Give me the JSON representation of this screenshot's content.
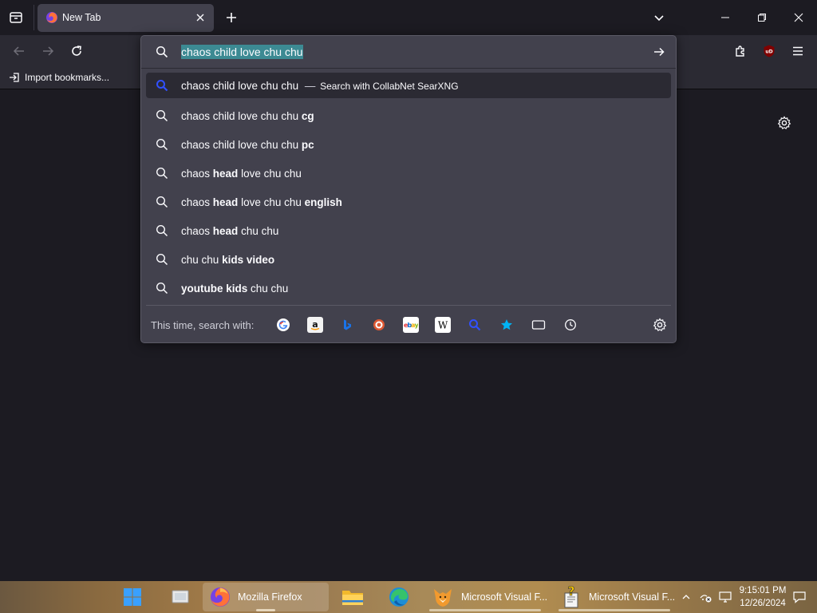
{
  "browser": {
    "tab_title": "New Tab",
    "bookmarks_import_label": "Import bookmarks..."
  },
  "urlbar": {
    "input_value": "chaos child love chu chu",
    "heuristic": {
      "text": "chaos child love chu chu",
      "dash": "—",
      "action": "Search with CollabNet SearXNG"
    },
    "suggestions": [
      {
        "plain": "chaos child love chu chu",
        "bold": "cg",
        "rest": ""
      },
      {
        "plain": "chaos child love chu chu",
        "bold": "pc",
        "rest": ""
      },
      {
        "plain": "chaos",
        "bold": "head",
        "rest": "love chu chu"
      },
      {
        "plain": "chaos",
        "bold": "head",
        "rest": "love chu chu",
        "bold2": "english"
      },
      {
        "plain": "chaos",
        "bold": "head",
        "rest": "chu chu"
      },
      {
        "plain": "chu chu",
        "bold": "kids video",
        "rest": ""
      },
      {
        "plain": "",
        "bold": "youtube kids",
        "rest": "chu chu"
      }
    ],
    "one_off_label": "This time, search with:",
    "engines": [
      {
        "name": "google-icon",
        "color": "#4285f4"
      },
      {
        "name": "amazon-icon",
        "color": "#f3f3f3"
      },
      {
        "name": "bing-icon",
        "color": "#1a73e8"
      },
      {
        "name": "duckduckgo-icon",
        "color": "#de5833"
      },
      {
        "name": "ebay-icon",
        "color": "#ffffff"
      },
      {
        "name": "wikipedia-icon",
        "color": "#ffffff"
      },
      {
        "name": "searxng-icon",
        "color": "#3050ff"
      },
      {
        "name": "bookmarks-star-icon",
        "color": "#00b3f4"
      },
      {
        "name": "tabs-icon",
        "color": "#fbfbfe"
      },
      {
        "name": "history-icon",
        "color": "#fbfbfe"
      }
    ]
  },
  "taskbar": {
    "firefox_label": "Mozilla Firefox",
    "vfp1_label": "Microsoft Visual F...",
    "vfp2_label": "Microsoft Visual F...",
    "time": "9:15:01 PM",
    "date": "12/26/2024"
  },
  "colors": {
    "accent_selection": "#3c8a93",
    "panel": "#42414d",
    "toolbar": "#2b2a33",
    "content": "#1c1b22"
  }
}
